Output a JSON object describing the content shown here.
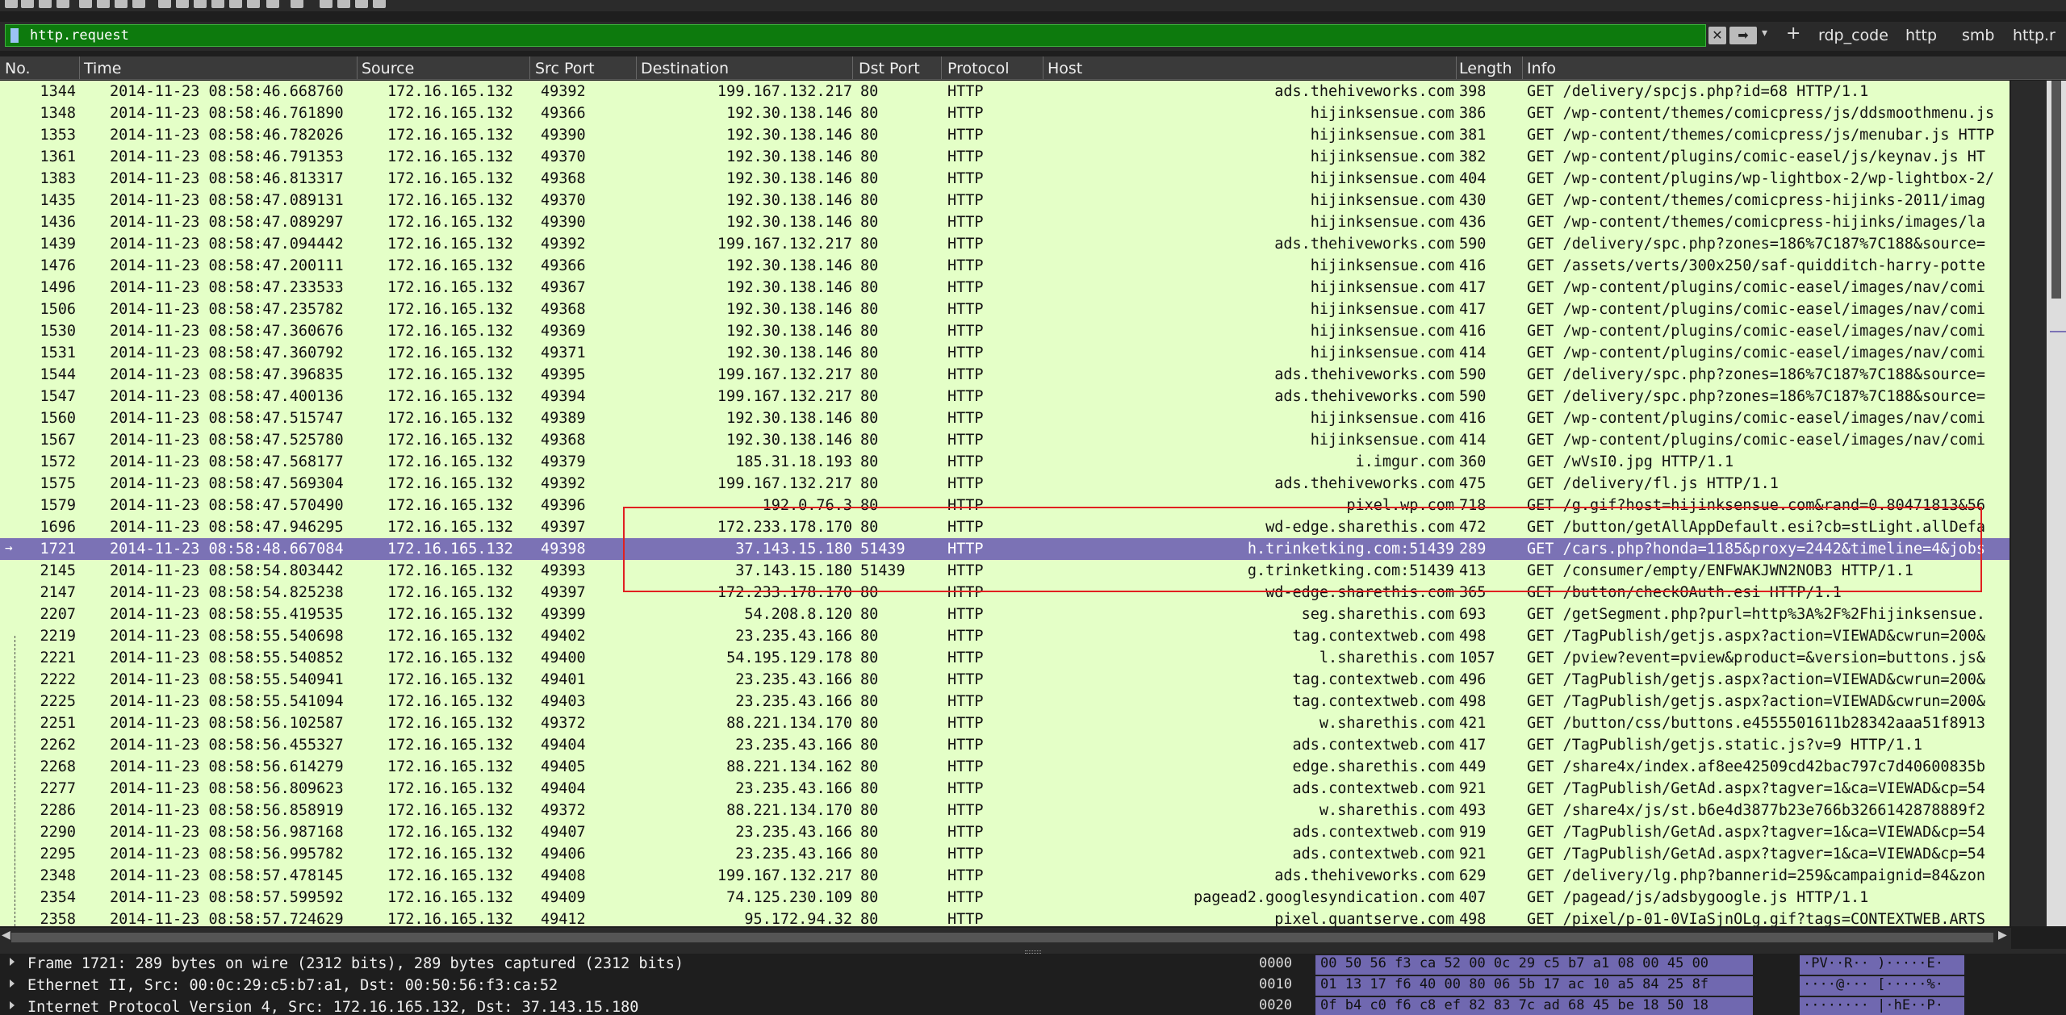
{
  "toolbar": {
    "icons": [
      "fin-icon",
      "stop-icon",
      "restart-icon",
      "options-icon",
      "open-icon",
      "save-icon",
      "close-icon",
      "reload-icon",
      "find-icon",
      "back-icon",
      "forward-icon",
      "goto-icon",
      "first-icon",
      "last-icon",
      "autoscroll-icon",
      "colorize-icon",
      "zoom-in-icon",
      "zoom-out-icon",
      "normal-size-icon",
      "resize-columns-icon"
    ]
  },
  "filter": {
    "value": "http.request",
    "clear_glyph": "✕",
    "apply_glyph": "➡",
    "dropdown_glyph": "▾",
    "add_glyph": "+",
    "buttons": [
      "rdp_code",
      "http",
      "smb",
      "http.r"
    ]
  },
  "columns": [
    "No.",
    "Time",
    "Source",
    "Src Port",
    "Destination",
    "Dst Port",
    "Protocol",
    "Host",
    "Length",
    "Info"
  ],
  "selected_arrow": "→",
  "packets": [
    {
      "no": "1344",
      "time": "2014-11-23 08:58:46.668760",
      "src": "172.16.165.132",
      "sport": "49392",
      "dst": "199.167.132.217",
      "dport": "80",
      "proto": "HTTP",
      "host": "ads.thehiveworks.com",
      "len": "398",
      "info": "GET /delivery/spcjs.php?id=68 HTTP/1.1"
    },
    {
      "no": "1348",
      "time": "2014-11-23 08:58:46.761890",
      "src": "172.16.165.132",
      "sport": "49366",
      "dst": "192.30.138.146",
      "dport": "80",
      "proto": "HTTP",
      "host": "hijinksensue.com",
      "len": "386",
      "info": "GET /wp-content/themes/comicpress/js/ddsmoothmenu.js"
    },
    {
      "no": "1353",
      "time": "2014-11-23 08:58:46.782026",
      "src": "172.16.165.132",
      "sport": "49390",
      "dst": "192.30.138.146",
      "dport": "80",
      "proto": "HTTP",
      "host": "hijinksensue.com",
      "len": "381",
      "info": "GET /wp-content/themes/comicpress/js/menubar.js HTTP"
    },
    {
      "no": "1361",
      "time": "2014-11-23 08:58:46.791353",
      "src": "172.16.165.132",
      "sport": "49370",
      "dst": "192.30.138.146",
      "dport": "80",
      "proto": "HTTP",
      "host": "hijinksensue.com",
      "len": "382",
      "info": "GET /wp-content/plugins/comic-easel/js/keynav.js HT"
    },
    {
      "no": "1383",
      "time": "2014-11-23 08:58:46.813317",
      "src": "172.16.165.132",
      "sport": "49368",
      "dst": "192.30.138.146",
      "dport": "80",
      "proto": "HTTP",
      "host": "hijinksensue.com",
      "len": "404",
      "info": "GET /wp-content/plugins/wp-lightbox-2/wp-lightbox-2/"
    },
    {
      "no": "1435",
      "time": "2014-11-23 08:58:47.089131",
      "src": "172.16.165.132",
      "sport": "49370",
      "dst": "192.30.138.146",
      "dport": "80",
      "proto": "HTTP",
      "host": "hijinksensue.com",
      "len": "430",
      "info": "GET /wp-content/themes/comicpress-hijinks-2011/imag"
    },
    {
      "no": "1436",
      "time": "2014-11-23 08:58:47.089297",
      "src": "172.16.165.132",
      "sport": "49390",
      "dst": "192.30.138.146",
      "dport": "80",
      "proto": "HTTP",
      "host": "hijinksensue.com",
      "len": "436",
      "info": "GET /wp-content/themes/comicpress-hijinks/images/la"
    },
    {
      "no": "1439",
      "time": "2014-11-23 08:58:47.094442",
      "src": "172.16.165.132",
      "sport": "49392",
      "dst": "199.167.132.217",
      "dport": "80",
      "proto": "HTTP",
      "host": "ads.thehiveworks.com",
      "len": "590",
      "info": "GET /delivery/spc.php?zones=186%7C187%7C188&source="
    },
    {
      "no": "1476",
      "time": "2014-11-23 08:58:47.200111",
      "src": "172.16.165.132",
      "sport": "49366",
      "dst": "192.30.138.146",
      "dport": "80",
      "proto": "HTTP",
      "host": "hijinksensue.com",
      "len": "416",
      "info": "GET /assets/verts/300x250/saf-quidditch-harry-potte"
    },
    {
      "no": "1496",
      "time": "2014-11-23 08:58:47.233533",
      "src": "172.16.165.132",
      "sport": "49367",
      "dst": "192.30.138.146",
      "dport": "80",
      "proto": "HTTP",
      "host": "hijinksensue.com",
      "len": "417",
      "info": "GET /wp-content/plugins/comic-easel/images/nav/comi"
    },
    {
      "no": "1506",
      "time": "2014-11-23 08:58:47.235782",
      "src": "172.16.165.132",
      "sport": "49368",
      "dst": "192.30.138.146",
      "dport": "80",
      "proto": "HTTP",
      "host": "hijinksensue.com",
      "len": "417",
      "info": "GET /wp-content/plugins/comic-easel/images/nav/comi"
    },
    {
      "no": "1530",
      "time": "2014-11-23 08:58:47.360676",
      "src": "172.16.165.132",
      "sport": "49369",
      "dst": "192.30.138.146",
      "dport": "80",
      "proto": "HTTP",
      "host": "hijinksensue.com",
      "len": "416",
      "info": "GET /wp-content/plugins/comic-easel/images/nav/comi"
    },
    {
      "no": "1531",
      "time": "2014-11-23 08:58:47.360792",
      "src": "172.16.165.132",
      "sport": "49371",
      "dst": "192.30.138.146",
      "dport": "80",
      "proto": "HTTP",
      "host": "hijinksensue.com",
      "len": "414",
      "info": "GET /wp-content/plugins/comic-easel/images/nav/comi"
    },
    {
      "no": "1544",
      "time": "2014-11-23 08:58:47.396835",
      "src": "172.16.165.132",
      "sport": "49395",
      "dst": "199.167.132.217",
      "dport": "80",
      "proto": "HTTP",
      "host": "ads.thehiveworks.com",
      "len": "590",
      "info": "GET /delivery/spc.php?zones=186%7C187%7C188&source="
    },
    {
      "no": "1547",
      "time": "2014-11-23 08:58:47.400136",
      "src": "172.16.165.132",
      "sport": "49394",
      "dst": "199.167.132.217",
      "dport": "80",
      "proto": "HTTP",
      "host": "ads.thehiveworks.com",
      "len": "590",
      "info": "GET /delivery/spc.php?zones=186%7C187%7C188&source="
    },
    {
      "no": "1560",
      "time": "2014-11-23 08:58:47.515747",
      "src": "172.16.165.132",
      "sport": "49389",
      "dst": "192.30.138.146",
      "dport": "80",
      "proto": "HTTP",
      "host": "hijinksensue.com",
      "len": "416",
      "info": "GET /wp-content/plugins/comic-easel/images/nav/comi"
    },
    {
      "no": "1567",
      "time": "2014-11-23 08:58:47.525780",
      "src": "172.16.165.132",
      "sport": "49368",
      "dst": "192.30.138.146",
      "dport": "80",
      "proto": "HTTP",
      "host": "hijinksensue.com",
      "len": "414",
      "info": "GET /wp-content/plugins/comic-easel/images/nav/comi"
    },
    {
      "no": "1572",
      "time": "2014-11-23 08:58:47.568177",
      "src": "172.16.165.132",
      "sport": "49379",
      "dst": "185.31.18.193",
      "dport": "80",
      "proto": "HTTP",
      "host": "i.imgur.com",
      "len": "360",
      "info": "GET /wVsI0.jpg HTTP/1.1"
    },
    {
      "no": "1575",
      "time": "2014-11-23 08:58:47.569304",
      "src": "172.16.165.132",
      "sport": "49392",
      "dst": "199.167.132.217",
      "dport": "80",
      "proto": "HTTP",
      "host": "ads.thehiveworks.com",
      "len": "475",
      "info": "GET /delivery/fl.js HTTP/1.1"
    },
    {
      "no": "1579",
      "time": "2014-11-23 08:58:47.570490",
      "src": "172.16.165.132",
      "sport": "49396",
      "dst": "192.0.76.3",
      "dport": "80",
      "proto": "HTTP",
      "host": "pixel.wp.com",
      "len": "718",
      "info": "GET /g.gif?host=hijinksensue.com&rand=0.80471813&56"
    },
    {
      "no": "1696",
      "time": "2014-11-23 08:58:47.946295",
      "src": "172.16.165.132",
      "sport": "49397",
      "dst": "172.233.178.170",
      "dport": "80",
      "proto": "HTTP",
      "host": "wd-edge.sharethis.com",
      "len": "472",
      "info": "GET /button/getAllAppDefault.esi?cb=stLight.allDefa"
    },
    {
      "no": "1721",
      "time": "2014-11-23 08:58:48.667084",
      "src": "172.16.165.132",
      "sport": "49398",
      "dst": "37.143.15.180",
      "dport": "51439",
      "proto": "HTTP",
      "host": "h.trinketking.com:51439",
      "len": "289",
      "info": "GET /cars.php?honda=1185&proxy=2442&timeline=4&jobs"
    },
    {
      "no": "2145",
      "time": "2014-11-23 08:58:54.803442",
      "src": "172.16.165.132",
      "sport": "49393",
      "dst": "37.143.15.180",
      "dport": "51439",
      "proto": "HTTP",
      "host": "g.trinketking.com:51439",
      "len": "413",
      "info": "GET /consumer/empty/ENFWAKJWN2NOB3 HTTP/1.1"
    },
    {
      "no": "2147",
      "time": "2014-11-23 08:58:54.825238",
      "src": "172.16.165.132",
      "sport": "49397",
      "dst": "172.233.178.170",
      "dport": "80",
      "proto": "HTTP",
      "host": "wd-edge.sharethis.com",
      "len": "365",
      "info": "GET /button/checkOAuth.esi HTTP/1.1"
    },
    {
      "no": "2207",
      "time": "2014-11-23 08:58:55.419535",
      "src": "172.16.165.132",
      "sport": "49399",
      "dst": "54.208.8.120",
      "dport": "80",
      "proto": "HTTP",
      "host": "seg.sharethis.com",
      "len": "693",
      "info": "GET /getSegment.php?purl=http%3A%2F%2Fhijinksensue."
    },
    {
      "no": "2219",
      "time": "2014-11-23 08:58:55.540698",
      "src": "172.16.165.132",
      "sport": "49402",
      "dst": "23.235.43.166",
      "dport": "80",
      "proto": "HTTP",
      "host": "tag.contextweb.com",
      "len": "498",
      "info": "GET /TagPublish/getjs.aspx?action=VIEWAD&cwrun=200&"
    },
    {
      "no": "2221",
      "time": "2014-11-23 08:58:55.540852",
      "src": "172.16.165.132",
      "sport": "49400",
      "dst": "54.195.129.178",
      "dport": "80",
      "proto": "HTTP",
      "host": "l.sharethis.com",
      "len": "1057",
      "info": "GET /pview?event=pview&product=&version=buttons.js&"
    },
    {
      "no": "2222",
      "time": "2014-11-23 08:58:55.540941",
      "src": "172.16.165.132",
      "sport": "49401",
      "dst": "23.235.43.166",
      "dport": "80",
      "proto": "HTTP",
      "host": "tag.contextweb.com",
      "len": "496",
      "info": "GET /TagPublish/getjs.aspx?action=VIEWAD&cwrun=200&"
    },
    {
      "no": "2225",
      "time": "2014-11-23 08:58:55.541094",
      "src": "172.16.165.132",
      "sport": "49403",
      "dst": "23.235.43.166",
      "dport": "80",
      "proto": "HTTP",
      "host": "tag.contextweb.com",
      "len": "498",
      "info": "GET /TagPublish/getjs.aspx?action=VIEWAD&cwrun=200&"
    },
    {
      "no": "2251",
      "time": "2014-11-23 08:58:56.102587",
      "src": "172.16.165.132",
      "sport": "49372",
      "dst": "88.221.134.170",
      "dport": "80",
      "proto": "HTTP",
      "host": "w.sharethis.com",
      "len": "421",
      "info": "GET /button/css/buttons.e4555501611b28342aaa51f8913"
    },
    {
      "no": "2262",
      "time": "2014-11-23 08:58:56.455327",
      "src": "172.16.165.132",
      "sport": "49404",
      "dst": "23.235.43.166",
      "dport": "80",
      "proto": "HTTP",
      "host": "ads.contextweb.com",
      "len": "417",
      "info": "GET /TagPublish/getjs.static.js?v=9 HTTP/1.1"
    },
    {
      "no": "2268",
      "time": "2014-11-23 08:58:56.614279",
      "src": "172.16.165.132",
      "sport": "49405",
      "dst": "88.221.134.162",
      "dport": "80",
      "proto": "HTTP",
      "host": "edge.sharethis.com",
      "len": "449",
      "info": "GET /share4x/index.af8ee42509cd42bac797c7d40600835b"
    },
    {
      "no": "2277",
      "time": "2014-11-23 08:58:56.809623",
      "src": "172.16.165.132",
      "sport": "49404",
      "dst": "23.235.43.166",
      "dport": "80",
      "proto": "HTTP",
      "host": "ads.contextweb.com",
      "len": "921",
      "info": "GET /TagPublish/GetAd.aspx?tagver=1&ca=VIEWAD&cp=54"
    },
    {
      "no": "2286",
      "time": "2014-11-23 08:58:56.858919",
      "src": "172.16.165.132",
      "sport": "49372",
      "dst": "88.221.134.170",
      "dport": "80",
      "proto": "HTTP",
      "host": "w.sharethis.com",
      "len": "493",
      "info": "GET /share4x/js/st.b6e4d3877b23e766b3266142878889f2"
    },
    {
      "no": "2290",
      "time": "2014-11-23 08:58:56.987168",
      "src": "172.16.165.132",
      "sport": "49407",
      "dst": "23.235.43.166",
      "dport": "80",
      "proto": "HTTP",
      "host": "ads.contextweb.com",
      "len": "919",
      "info": "GET /TagPublish/GetAd.aspx?tagver=1&ca=VIEWAD&cp=54"
    },
    {
      "no": "2295",
      "time": "2014-11-23 08:58:56.995782",
      "src": "172.16.165.132",
      "sport": "49406",
      "dst": "23.235.43.166",
      "dport": "80",
      "proto": "HTTP",
      "host": "ads.contextweb.com",
      "len": "921",
      "info": "GET /TagPublish/GetAd.aspx?tagver=1&ca=VIEWAD&cp=54"
    },
    {
      "no": "2348",
      "time": "2014-11-23 08:58:57.478145",
      "src": "172.16.165.132",
      "sport": "49408",
      "dst": "199.167.132.217",
      "dport": "80",
      "proto": "HTTP",
      "host": "ads.thehiveworks.com",
      "len": "629",
      "info": "GET /delivery/lg.php?bannerid=259&campaignid=84&zon"
    },
    {
      "no": "2354",
      "time": "2014-11-23 08:58:57.599592",
      "src": "172.16.165.132",
      "sport": "49409",
      "dst": "74.125.230.109",
      "dport": "80",
      "proto": "HTTP",
      "host": "pagead2.googlesyndication.com",
      "len": "407",
      "info": "GET /pagead/js/adsbygoogle.js HTTP/1.1"
    },
    {
      "no": "2358",
      "time": "2014-11-23 08:58:57.724629",
      "src": "172.16.165.132",
      "sport": "49412",
      "dst": "95.172.94.32",
      "dport": "80",
      "proto": "HTTP",
      "host": "pixel.quantserve.com",
      "len": "498",
      "info": "GET /pixel/p-01-0VIaSjnOLg.gif?tags=CONTEXTWEB.ARTS"
    }
  ],
  "selected_index": 21,
  "details": [
    "Frame 1721: 289 bytes on wire (2312 bits), 289 bytes captured (2312 bits)",
    "Ethernet II, Src: 00:0c:29:c5:b7:a1, Dst: 00:50:56:f3:ca:52",
    "Internet Protocol Version 4, Src: 172.16.165.132, Dst: 37.143.15.180"
  ],
  "bytes": [
    {
      "offset": "0000",
      "hex": "00 50 56 f3 ca 52 00 0c  29 c5 b7 a1 08 00 45 00",
      "ascii": "·PV··R·· )·····E·"
    },
    {
      "offset": "0010",
      "hex": "01 13 17 f6 40 00 80 06  5b 17 ac 10 a5 84 25 8f",
      "ascii": "····@··· [·····%·"
    },
    {
      "offset": "0020",
      "hex": "0f b4 c0 f6 c8 ef 82 83  7c ad 68 45 be 18 50 18",
      "ascii": "········ |·hE··P·"
    }
  ],
  "colors": {
    "row_bg": "#e4ffc7",
    "selected": "#7b72b5",
    "filter_ok": "#0d7a0d",
    "annotation": "#e02020"
  }
}
